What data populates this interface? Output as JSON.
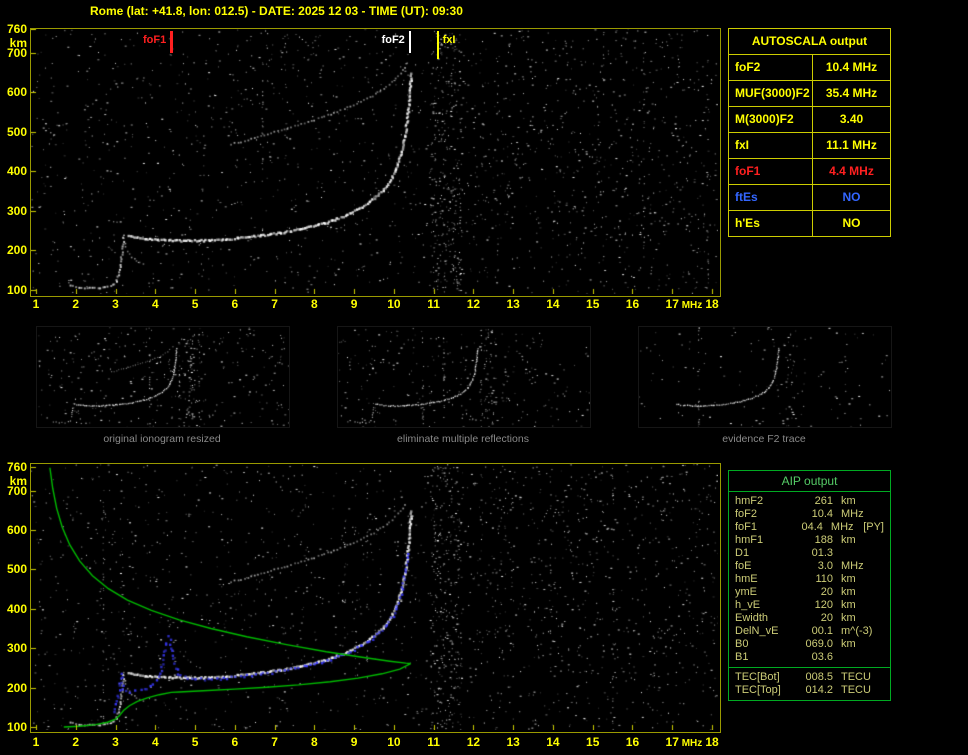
{
  "title": "Rome (lat: +41.8, lon: 012.5) - DATE: 2025 12 03 - TIME (UT): 09:30",
  "axes": {
    "x_ticks": [
      1,
      2,
      3,
      4,
      5,
      6,
      7,
      8,
      9,
      10,
      11,
      12,
      13,
      14,
      15,
      16,
      17,
      18
    ],
    "x_unit": "MHz",
    "y_ticks": [
      760,
      700,
      600,
      500,
      400,
      300,
      200,
      100
    ],
    "y_unit": "km"
  },
  "markers": [
    {
      "label": "foF1",
      "freq": 4.4,
      "color": "#ff2020",
      "side": "left"
    },
    {
      "label": "foF2",
      "freq": 10.4,
      "color": "#ffffff",
      "side": "left"
    },
    {
      "label": "fxI",
      "freq": 11.1,
      "color": "#ffff00",
      "side": "right"
    }
  ],
  "autoscala_table": {
    "header": "AUTOSCALA output",
    "rows": [
      {
        "name": "foF2",
        "value": "10.4 MHz",
        "color": "#ffff00"
      },
      {
        "name": "MUF(3000)F2",
        "value": "35.4 MHz",
        "color": "#ffff00"
      },
      {
        "name": "M(3000)F2",
        "value": "3.40",
        "color": "#ffff00"
      },
      {
        "name": "fxI",
        "value": "11.1 MHz",
        "color": "#ffff00"
      },
      {
        "name": "foF1",
        "value": "4.4 MHz",
        "color": "#ff2020"
      },
      {
        "name": "ftEs",
        "value": "NO",
        "color": "#3366ff"
      },
      {
        "name": "h'Es",
        "value": "NO",
        "color": "#ffff00"
      }
    ]
  },
  "aip_table": {
    "header": "AIP output",
    "rows": [
      {
        "name": "hmF2",
        "value": "261",
        "unit": "km",
        "extra": ""
      },
      {
        "name": "foF2",
        "value": "10.4",
        "unit": "MHz",
        "extra": ""
      },
      {
        "name": "foF1",
        "value": "04.4",
        "unit": "MHz",
        "extra": "[PY]"
      },
      {
        "name": "hmF1",
        "value": "188",
        "unit": "km",
        "extra": ""
      },
      {
        "name": "D1",
        "value": "01.3",
        "unit": "",
        "extra": ""
      },
      {
        "name": "foE",
        "value": "3.0",
        "unit": "MHz",
        "extra": ""
      },
      {
        "name": "hmE",
        "value": "110",
        "unit": "km",
        "extra": ""
      },
      {
        "name": "ymE",
        "value": "20",
        "unit": "km",
        "extra": ""
      },
      {
        "name": "h_vE",
        "value": "120",
        "unit": "km",
        "extra": ""
      },
      {
        "name": "Ewidth",
        "value": "20",
        "unit": "km",
        "extra": ""
      },
      {
        "name": "DelN_vE",
        "value": "00.1",
        "unit": "m^(-3)",
        "extra": ""
      },
      {
        "name": "B0",
        "value": "069.0",
        "unit": "km",
        "extra": ""
      },
      {
        "name": "B1",
        "value": "03.6",
        "unit": "",
        "extra": ""
      }
    ],
    "tec_rows": [
      {
        "name": "TEC[Bot]",
        "value": "008.5",
        "unit": "TECU"
      },
      {
        "name": "TEC[Top]",
        "value": "014.2",
        "unit": "TECU"
      }
    ]
  },
  "thumbnails": [
    {
      "caption": "original ionogram resized"
    },
    {
      "caption": "eliminate multiple reflections"
    },
    {
      "caption": "evidence F2 trace"
    }
  ],
  "chart_data": [
    {
      "type": "scatter",
      "title": "ionogram (autoscaled)",
      "xlabel": "MHz",
      "ylabel": "km",
      "xlim": [
        1,
        18
      ],
      "ylim": [
        100,
        760
      ],
      "annotations": {
        "foF1_MHz": 4.4,
        "foF2_MHz": 10.4,
        "fxI_MHz": 11.1
      },
      "series": [
        {
          "name": "F2-trace",
          "color": "#ffffff",
          "points": [
            [
              3.3,
              240
            ],
            [
              3.6,
              234
            ],
            [
              3.9,
              230
            ],
            [
              4.3,
              228
            ],
            [
              4.8,
              227
            ],
            [
              5.3,
              228
            ],
            [
              5.8,
              231
            ],
            [
              6.3,
              236
            ],
            [
              6.8,
              242
            ],
            [
              7.3,
              250
            ],
            [
              7.8,
              260
            ],
            [
              8.3,
              273
            ],
            [
              8.7,
              288
            ],
            [
              9.1,
              307
            ],
            [
              9.4,
              327
            ],
            [
              9.7,
              352
            ],
            [
              9.9,
              380
            ],
            [
              10.05,
              412
            ],
            [
              10.18,
              452
            ],
            [
              10.27,
              500
            ],
            [
              10.33,
              548
            ],
            [
              10.38,
              600
            ],
            [
              10.42,
              655
            ]
          ]
        },
        {
          "name": "F2-second-reflection",
          "color": "#e0e0e0",
          "points": [
            [
              5.9,
              470
            ],
            [
              6.4,
              484
            ],
            [
              6.9,
              498
            ],
            [
              7.4,
              513
            ],
            [
              7.9,
              529
            ],
            [
              8.4,
              547
            ],
            [
              8.9,
              566
            ],
            [
              9.3,
              585
            ],
            [
              9.65,
              605
            ],
            [
              9.95,
              628
            ],
            [
              10.15,
              650
            ],
            [
              10.3,
              672
            ]
          ]
        },
        {
          "name": "E-trace",
          "color": "#ffffff",
          "points": [
            [
              1.85,
              112
            ],
            [
              2.2,
              107
            ],
            [
              2.6,
              106
            ],
            [
              2.85,
              111
            ],
            [
              3.0,
              122
            ],
            [
              3.07,
              148
            ],
            [
              3.12,
              180
            ],
            [
              3.16,
              212
            ],
            [
              3.19,
              240
            ]
          ]
        },
        {
          "name": "E-cusp-descent",
          "color": "#ffffff",
          "points": [
            [
              3.19,
              240
            ],
            [
              3.25,
              210
            ],
            [
              3.33,
              192
            ],
            [
              3.45,
              180
            ],
            [
              3.6,
              172
            ],
            [
              3.8,
              167
            ]
          ]
        }
      ]
    },
    {
      "type": "scatter",
      "title": "ionogram with AIP electron density profile",
      "xlabel": "MHz",
      "ylabel": "km",
      "xlim": [
        1,
        18
      ],
      "ylim": [
        100,
        760
      ],
      "series": [
        {
          "name": "restored-trace-blue",
          "color": "#3a3aff",
          "points": [
            [
              2.95,
              140
            ],
            [
              3.05,
              185
            ],
            [
              3.12,
              235
            ],
            [
              3.18,
              200
            ],
            [
              3.35,
              192
            ],
            [
              3.6,
              196
            ],
            [
              3.85,
              205
            ],
            [
              4.0,
              222
            ],
            [
              4.12,
              248
            ],
            [
              4.2,
              282
            ],
            [
              4.27,
              318
            ],
            [
              4.32,
              332
            ],
            [
              4.38,
              295
            ],
            [
              4.45,
              262
            ],
            [
              4.55,
              238
            ],
            [
              4.7,
              228
            ],
            [
              5.0,
              224
            ],
            [
              5.4,
              224
            ],
            [
              5.9,
              228
            ],
            [
              6.4,
              234
            ],
            [
              6.9,
              241
            ],
            [
              7.4,
              250
            ],
            [
              7.9,
              261
            ],
            [
              8.4,
              275
            ],
            [
              8.8,
              291
            ],
            [
              9.2,
              310
            ],
            [
              9.5,
              330
            ],
            [
              9.75,
              355
            ],
            [
              9.95,
              385
            ],
            [
              10.1,
              420
            ],
            [
              10.2,
              460
            ],
            [
              10.28,
              505
            ],
            [
              10.33,
              550
            ]
          ]
        },
        {
          "name": "profile-topside-green",
          "color": "#00bb00",
          "points": [
            [
              1.35,
              758
            ],
            [
              1.42,
              706
            ],
            [
              1.52,
              655
            ],
            [
              1.66,
              607
            ],
            [
              1.85,
              562
            ],
            [
              2.1,
              521
            ],
            [
              2.42,
              484
            ],
            [
              2.82,
              451
            ],
            [
              3.3,
              422
            ],
            [
              3.9,
              396
            ],
            [
              4.6,
              372
            ],
            [
              5.4,
              350
            ],
            [
              6.3,
              329
            ],
            [
              7.3,
              309
            ],
            [
              8.3,
              291
            ],
            [
              9.2,
              277
            ],
            [
              9.9,
              267
            ],
            [
              10.3,
              262
            ],
            [
              10.42,
              261
            ]
          ]
        },
        {
          "name": "profile-bottomside-green",
          "color": "#00bb00",
          "points": [
            [
              10.42,
              261
            ],
            [
              10.15,
              247
            ],
            [
              9.7,
              235
            ],
            [
              9.1,
              224
            ],
            [
              8.4,
              215
            ],
            [
              7.6,
              207
            ],
            [
              6.8,
              201
            ],
            [
              6.0,
              196
            ],
            [
              5.2,
              192
            ],
            [
              4.6,
              189
            ],
            [
              4.4,
              188
            ],
            [
              4.1,
              182
            ],
            [
              3.8,
              174
            ],
            [
              3.55,
              165
            ],
            [
              3.35,
              154
            ],
            [
              3.2,
              142
            ],
            [
              3.1,
              129
            ],
            [
              3.0,
              120
            ],
            [
              2.8,
              112
            ],
            [
              2.5,
              106
            ],
            [
              2.1,
              102
            ],
            [
              1.7,
              100
            ]
          ]
        }
      ]
    }
  ]
}
